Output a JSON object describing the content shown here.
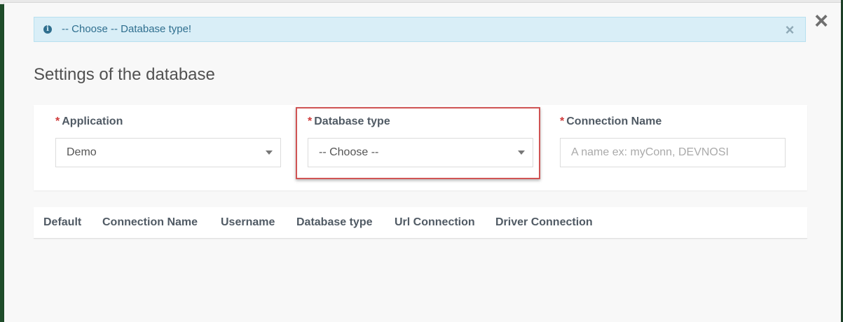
{
  "alert": {
    "text": "-- Choose -- Database type!"
  },
  "page": {
    "title": "Settings of the database"
  },
  "form": {
    "required_mark": "*",
    "application": {
      "label": "Application",
      "value": "Demo"
    },
    "database_type": {
      "label": "Database type",
      "value": "-- Choose --"
    },
    "connection_name": {
      "label": "Connection Name",
      "value": "",
      "placeholder": "A name ex: myConn, DEVNOSI"
    }
  },
  "table": {
    "columns": [
      "Default",
      "Connection Name",
      "Username",
      "Database type",
      "Url Connection",
      "Driver Connection"
    ]
  },
  "icons": {
    "alert": "info-circle-icon",
    "alert_close": "close-icon",
    "modal_close": "close-icon",
    "dropdown": "caret-down-icon"
  },
  "colors": {
    "alert_bg": "#d9eef7",
    "alert_text": "#2f6f8f",
    "required": "#cf3b3b",
    "highlight": "#d05454"
  }
}
